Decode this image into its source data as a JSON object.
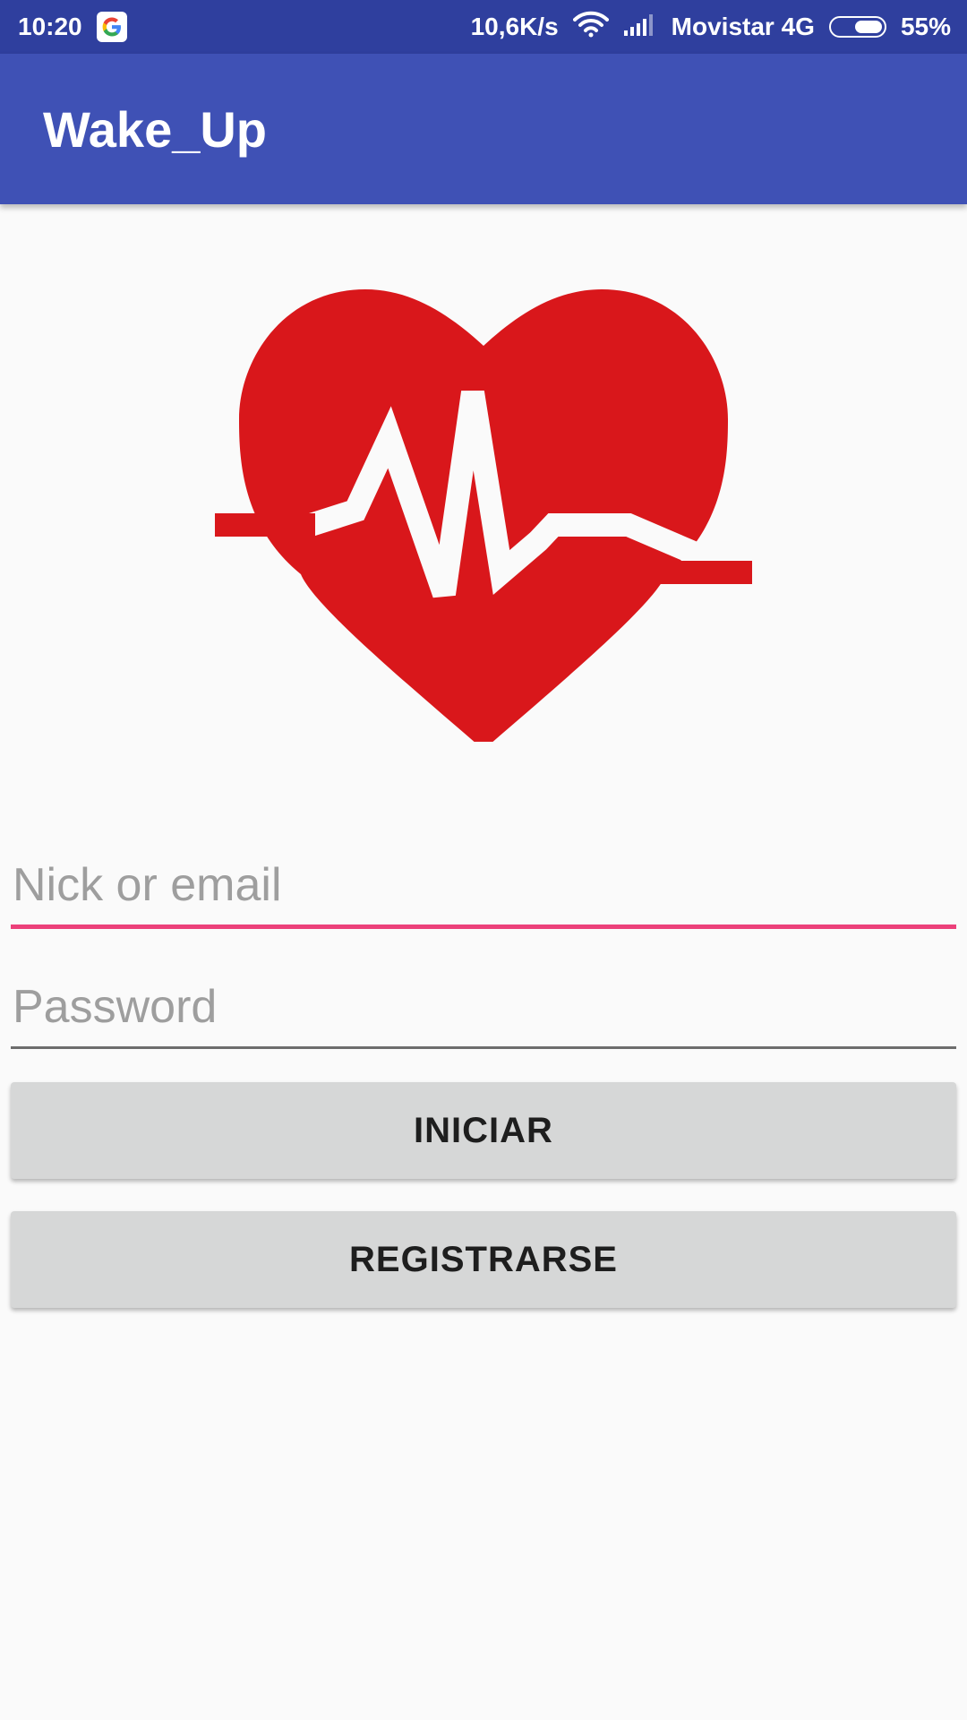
{
  "status_bar": {
    "time": "10:20",
    "net_speed": "10,6K/s",
    "carrier": "Movistar 4G",
    "battery": "55%",
    "battery_level": 0.55,
    "icons": [
      "google-icon",
      "wifi-icon",
      "signal-icon",
      "battery-icon"
    ]
  },
  "app_bar": {
    "title": "Wake_Up"
  },
  "logo": {
    "icon": "heart-pulse-icon",
    "color": "#d9171b"
  },
  "form": {
    "nick_placeholder": "Nick or email",
    "nick_value": "",
    "password_placeholder": "Password",
    "password_value": ""
  },
  "buttons": {
    "login_label": "INICIAR",
    "register_label": "REGISTRARSE"
  },
  "colors": {
    "primary": "#3f51b5",
    "primary_dark": "#2f3f9e",
    "accent": "#ec407a",
    "button": "#d6d7d7",
    "background": "#fafafa"
  }
}
